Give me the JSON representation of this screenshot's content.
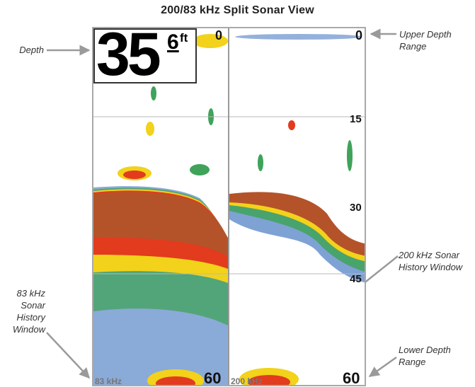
{
  "title": "200/83 kHz Split Sonar View",
  "callouts": {
    "depth": [
      "Depth"
    ],
    "upper_depth_range": [
      "Upper Depth",
      "Range"
    ],
    "sonar_200": [
      "200 kHz Sonar",
      "History Window"
    ],
    "sonar_83": [
      "83 kHz",
      "Sonar",
      "History",
      "Window"
    ],
    "lower_depth_range": [
      "Lower Depth",
      "Range"
    ]
  },
  "screen": {
    "depth_readout": {
      "whole": "35",
      "decimal": "6",
      "unit": "ft"
    },
    "left_panel": {
      "top_range": "0",
      "bottom_range": "60",
      "frequency_label": "83 kHz"
    },
    "right_panel": {
      "scale_top": "0",
      "scale_marks": [
        "15",
        "30",
        "45"
      ],
      "scale_bottom": "60",
      "frequency_label": "200 kHz"
    }
  },
  "colors": {
    "bottom_return_strong": "#b4532a",
    "bottom_return_medium": "#e23b1e",
    "return_yellow": "#f2d21a",
    "return_green": "#3fa35a",
    "return_blue": "#2a64b8",
    "screen_border": "#a9a9a9",
    "arrow": "#9a9a9a"
  }
}
